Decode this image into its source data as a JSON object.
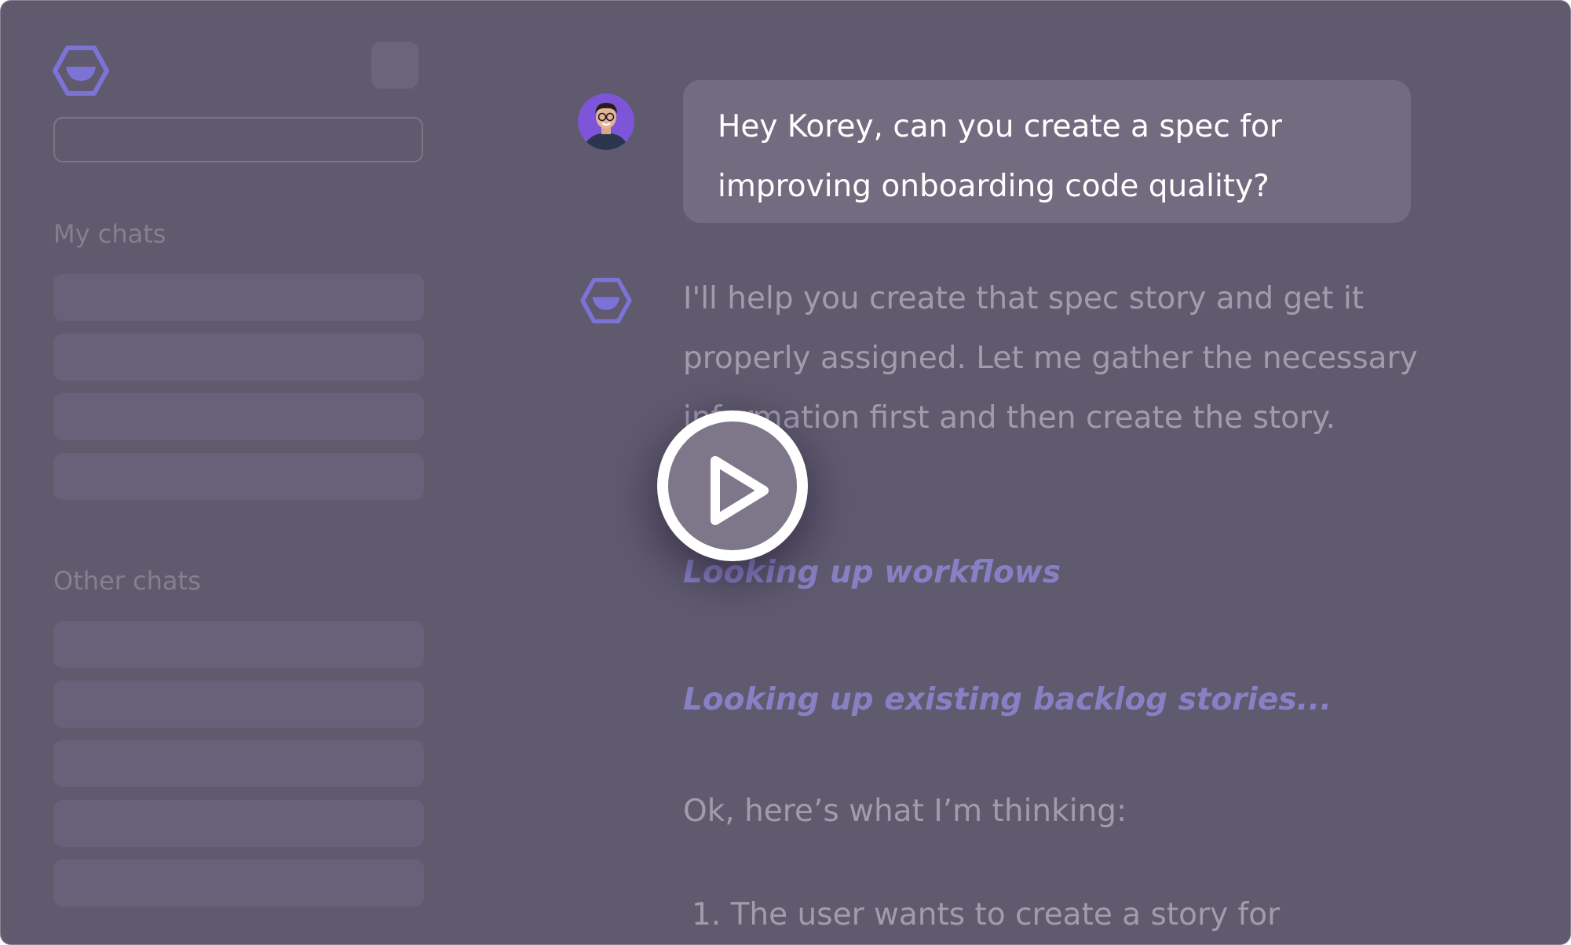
{
  "sidebar": {
    "search": {
      "placeholder": "",
      "value": ""
    },
    "my_chats_label": "My chats",
    "other_chats_label": "Other chats"
  },
  "conversation": {
    "user_message": "Hey Korey, can you create a spec for improving onboarding code quality?",
    "assistant_intro": "I'll help you create that spec story and get it properly assigned. Let me gather the necessary information first and then create the story.",
    "tool_calls": [
      "Looking up workflows",
      "Looking up existing backlog stories..."
    ],
    "assistant_followup": "Ok, here’s what I’m thinking:",
    "list_item_1": "1. The user wants to create a story for"
  },
  "icons": {
    "logo": "hexagon-logo-icon",
    "new_chat": "new-chat-icon",
    "avatar": "user-avatar",
    "bot": "assistant-logo-icon",
    "play": "play-icon"
  },
  "colors": {
    "background": "#5f5a6e",
    "accent": "#7c73d6",
    "user_bubble": "#736c81",
    "tool_text": "#8880c4"
  }
}
